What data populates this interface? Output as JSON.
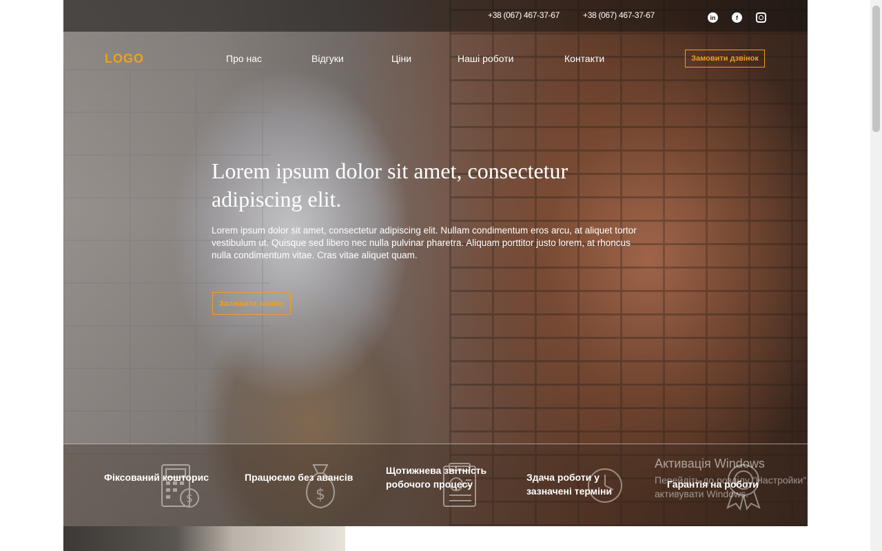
{
  "topbar": {
    "phone_1": "+38 (067) 467-37-67",
    "phone_2": "+38 (067) 467-37-67",
    "socials": [
      {
        "name": "linkedin-icon",
        "glyph": "in"
      },
      {
        "name": "facebook-icon",
        "glyph": "f"
      },
      {
        "name": "instagram-icon",
        "glyph": ""
      }
    ]
  },
  "header": {
    "logo": "LOGO",
    "nav": [
      "Про нас",
      "Відгуки",
      "Ціни",
      "Наші роботи",
      "Контакти"
    ],
    "callback_label": "Замовити дзвінок"
  },
  "hero": {
    "title": "Lorem ipsum dolor sit amet, consectetur adipiscing elit.",
    "text": "Lorem ipsum dolor sit amet, consectetur adipiscing elit. Nullam condimentum eros arcu, at aliquet tortor vestibulum ut. Quisque sed libero nec nulla pulvinar pharetra. Aliquam porttitor justo lorem, at rhoncus nulla condimentum vitae. Cras vitae aliquet quam.",
    "request_label": "Залишити заявку"
  },
  "features": [
    {
      "label": "Фіксований кошторис",
      "icon": "calculator-icon"
    },
    {
      "label": "Працюємо без авансів",
      "icon": "money-bag-icon"
    },
    {
      "label": "Щотижнева звітність робочого процесу",
      "icon": "report-icon"
    },
    {
      "label": "Здача роботи у зазначені терміни",
      "icon": "clock-icon"
    },
    {
      "label": "Гарантія на роботи",
      "icon": "award-icon"
    }
  ],
  "watermark": {
    "title": "Активація Windows",
    "line_1": "Перейдіть до розділу \"Настройки\", щоб",
    "line_2": "активувати Windows."
  },
  "colors": {
    "accent": "#f0a21b"
  }
}
